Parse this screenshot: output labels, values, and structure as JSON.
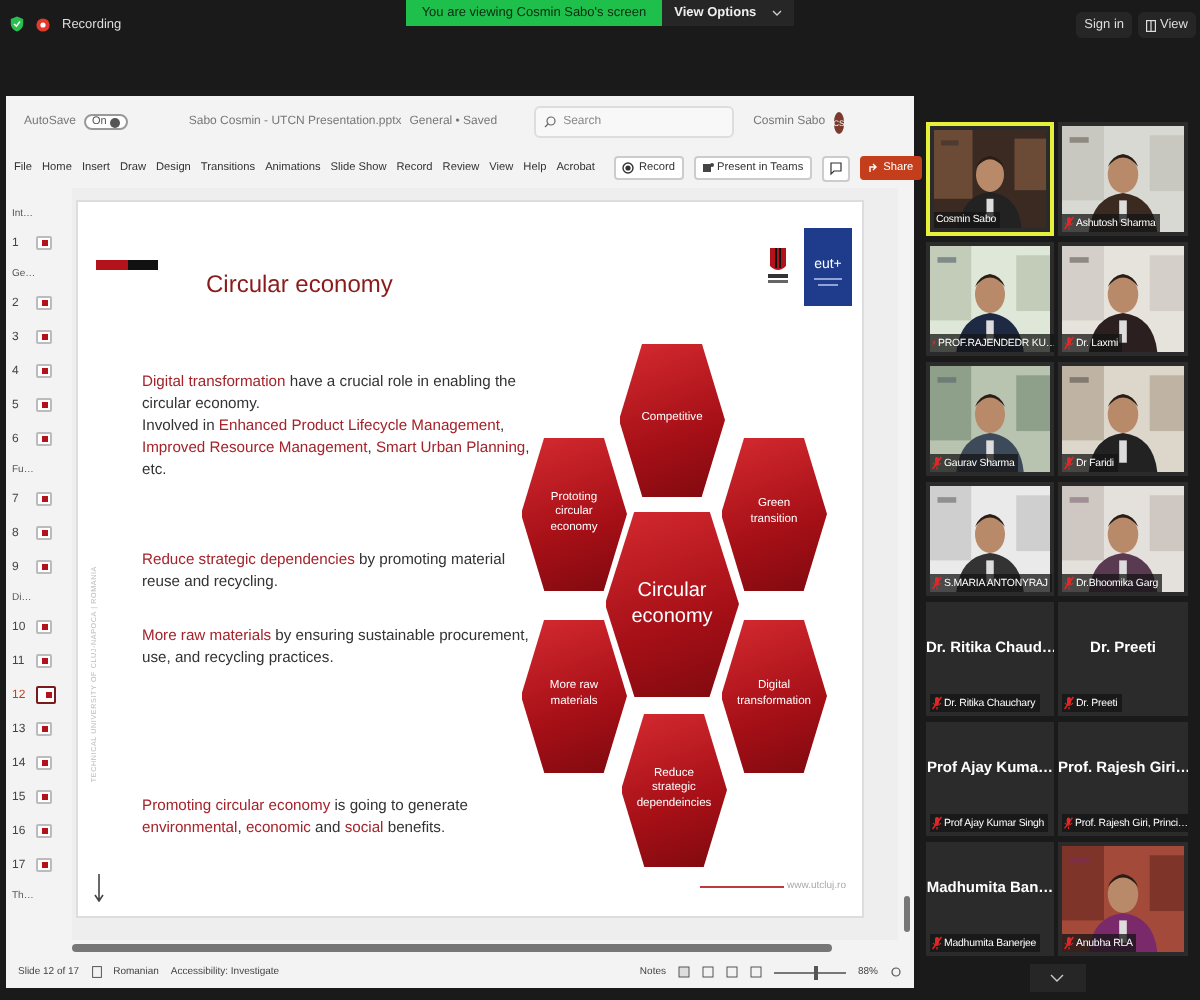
{
  "meeting_bar": {
    "recording": "Recording",
    "banner": "You are viewing Cosmin Sabo's screen",
    "view_options": "View Options",
    "sign_in": "Sign in",
    "view": "View"
  },
  "app": {
    "autosave": "AutoSave",
    "autosave_toggle": "On",
    "autosave_on": true,
    "file_name": "Sabo Cosmin - UTCN Presentation.pptx",
    "sensitivity": "General • Saved",
    "search": {
      "placeholder": "Search"
    },
    "user": "Cosmin Sabo",
    "avatar": "CS",
    "tabs": [
      "File",
      "Home",
      "Insert",
      "Draw",
      "Design",
      "Transitions",
      "Animations",
      "Slide Show",
      "Record",
      "Review",
      "View",
      "Help",
      "Acrobat"
    ],
    "actions": [
      {
        "kind": "record",
        "label": "Record"
      },
      {
        "kind": "teams",
        "label": "Present in Teams"
      },
      {
        "kind": "comment"
      },
      {
        "kind": "share",
        "label": "Share"
      }
    ]
  },
  "sections": [
    {
      "label": "Int…",
      "slides": [
        {
          "number": "1",
          "selected": false
        }
      ]
    },
    {
      "label": "Ge…",
      "slides": [
        {
          "number": "2",
          "selected": false
        },
        {
          "number": "3",
          "selected": false
        },
        {
          "number": "4",
          "selected": false
        },
        {
          "number": "5",
          "selected": false
        },
        {
          "number": "6",
          "selected": false
        }
      ]
    },
    {
      "label": "Fu…",
      "slides": [
        {
          "number": "7",
          "selected": false
        },
        {
          "number": "8",
          "selected": false
        },
        {
          "number": "9",
          "selected": false
        }
      ]
    },
    {
      "label": "Di…",
      "slides": [
        {
          "number": "10",
          "selected": false
        },
        {
          "number": "11",
          "selected": false
        },
        {
          "number": "12",
          "selected": true
        },
        {
          "number": "13",
          "selected": false
        },
        {
          "number": "14",
          "selected": false
        },
        {
          "number": "15",
          "selected": false
        },
        {
          "number": "16",
          "selected": false
        },
        {
          "number": "17",
          "selected": false
        }
      ]
    },
    {
      "label": "Th…"
    }
  ],
  "slide": {
    "title": "Circular economy",
    "side_text": "TECHNICAL UNIVERSITY OF CLUJ-NAPOCA  |  ROMANIA",
    "logo_text": "eut+",
    "footer": "www.utcluj.ro",
    "blocks": [
      [
        [
          {
            "text": "Digital transformation",
            "highlight": true
          },
          {
            "text": " have a crucial role in enabling the circular economy.",
            "highlight": false
          }
        ],
        [
          {
            "text": "Involved in ",
            "highlight": false
          },
          {
            "text": "Enhanced Product Lifecycle Management",
            "highlight": true
          },
          {
            "text": ", ",
            "highlight": false
          },
          {
            "text": "Improved Resource Management",
            "highlight": true
          },
          {
            "text": ", ",
            "highlight": false
          },
          {
            "text": "Smart Urban Planning",
            "highlight": true
          },
          {
            "text": ", etc.",
            "highlight": false
          }
        ]
      ],
      [
        [
          {
            "text": "Reduce strategic dependencies",
            "highlight": true
          },
          {
            "text": " by promoting material reuse and recycling.",
            "highlight": false
          }
        ]
      ],
      [
        [
          {
            "text": "More raw materials",
            "highlight": true
          },
          {
            "text": " by ensuring sustainable procurement, use, and recycling practices.",
            "highlight": false
          }
        ]
      ],
      [
        [
          {
            "text": "Promoting circular economy",
            "highlight": true
          },
          {
            "text": " is going to generate ",
            "highlight": false
          },
          {
            "text": "environmental",
            "highlight": true
          },
          {
            "text": ", ",
            "highlight": false
          },
          {
            "text": "economic",
            "highlight": true
          },
          {
            "text": " and ",
            "highlight": false
          },
          {
            "text": "social",
            "highlight": true
          },
          {
            "text": " benefits.",
            "highlight": false
          }
        ]
      ]
    ],
    "hexagons": [
      {
        "label": "Competitive",
        "kind": "outer"
      },
      {
        "label": "Prototing circular economy",
        "kind": "outer"
      },
      {
        "label": "Green transition",
        "kind": "outer"
      },
      {
        "label": "Circular economy",
        "kind": "main"
      },
      {
        "label": "More raw materials",
        "kind": "outer"
      },
      {
        "label": "Digital transformation",
        "kind": "outer"
      },
      {
        "label": "Reduce strategic dependeincies",
        "kind": "outer"
      }
    ]
  },
  "status_bar": {
    "slide_info": "Slide 12 of 17",
    "language": "Romanian",
    "accessibility": "Accessibility: Investigate",
    "notes": "Notes",
    "zoom": {
      "level": 0.55
    },
    "zoom_reading": "88%"
  },
  "participants": [
    {
      "name": "Cosmin Sabo",
      "kind": "video",
      "muted": false,
      "speaking": true
    },
    {
      "name": "Ashutosh Sharma",
      "kind": "video",
      "muted": true,
      "speaking": false
    },
    {
      "name": "PROF.RAJENDEDR KU…",
      "kind": "video",
      "muted": true,
      "speaking": false
    },
    {
      "name": "Dr. Laxmi",
      "kind": "video",
      "muted": true,
      "speaking": false
    },
    {
      "name": "Gaurav Sharma",
      "kind": "video",
      "muted": true,
      "speaking": false
    },
    {
      "name": "Dr Faridi",
      "kind": "video",
      "muted": true,
      "speaking": false
    },
    {
      "name": "S.MARIA ANTONYRAJ",
      "kind": "video",
      "muted": true,
      "speaking": false
    },
    {
      "name": "Dr.Bhoomika Garg",
      "kind": "video",
      "muted": true,
      "speaking": false
    },
    {
      "name": "Dr. Ritika Chauchary",
      "display": "Dr. Ritika Chaud…",
      "kind": "name",
      "muted": true,
      "speaking": false
    },
    {
      "name": "Dr. Preeti",
      "display": "Dr. Preeti",
      "kind": "name",
      "muted": true,
      "speaking": false
    },
    {
      "name": "Prof Ajay Kumar Singh",
      "display": "Prof Ajay Kuma…",
      "kind": "name",
      "muted": true,
      "speaking": false
    },
    {
      "name": "Prof. Rajesh Giri, Princi…",
      "display": "Prof. Rajesh Giri…",
      "kind": "name",
      "muted": true,
      "speaking": false
    },
    {
      "name": "Madhumita Banerjee",
      "display": "Madhumita Ban…",
      "kind": "name",
      "muted": true,
      "speaking": false
    },
    {
      "name": "Anubha RLA",
      "kind": "video",
      "muted": true,
      "speaking": false
    }
  ]
}
